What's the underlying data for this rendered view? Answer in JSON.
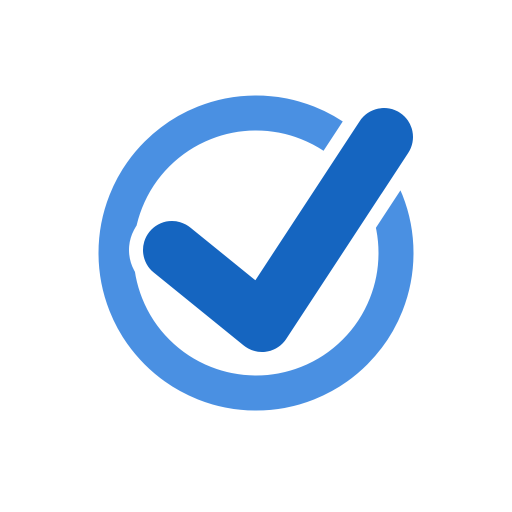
{
  "icon": {
    "name": "check-circle-icon",
    "ring_color": "#4A90E2",
    "check_color": "#1565C0",
    "background": "#FFFFFF"
  }
}
